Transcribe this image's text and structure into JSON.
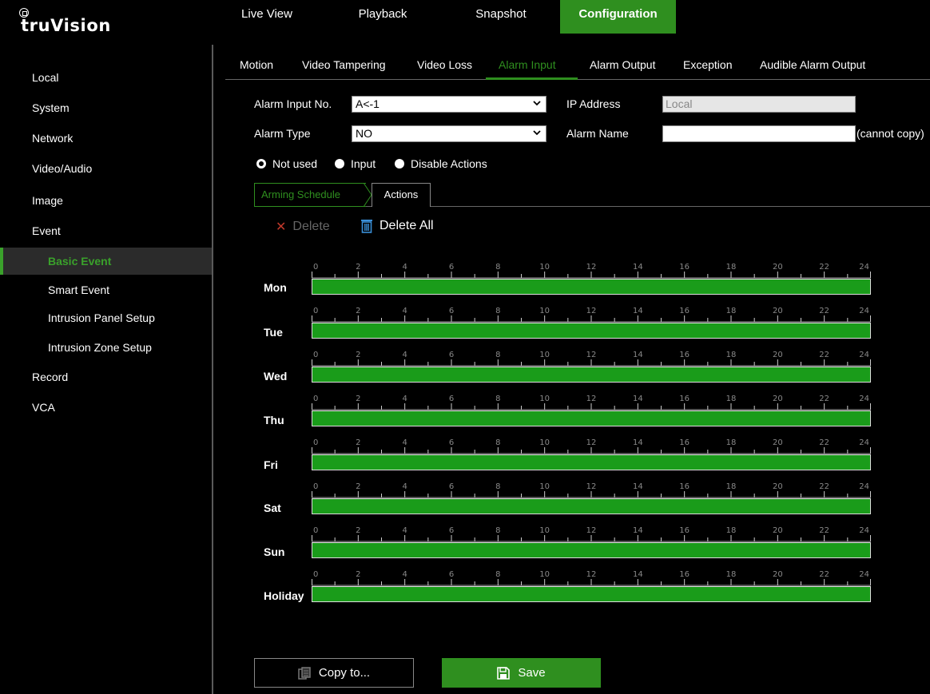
{
  "app": {
    "logo_text": "truVision"
  },
  "top_nav": [
    {
      "label": "Live View"
    },
    {
      "label": "Playback"
    },
    {
      "label": "Snapshot"
    },
    {
      "label": "Configuration"
    }
  ],
  "sidebar": {
    "items": [
      {
        "label": "Local"
      },
      {
        "label": "System"
      },
      {
        "label": "Network"
      },
      {
        "label": "Video/Audio"
      },
      {
        "label": "Image"
      },
      {
        "label": "Event"
      },
      {
        "label": "Basic Event"
      },
      {
        "label": "Smart Event"
      },
      {
        "label": "Intrusion Panel Setup"
      },
      {
        "label": "Intrusion Zone Setup"
      },
      {
        "label": "Record"
      },
      {
        "label": "VCA"
      }
    ]
  },
  "subtabs": [
    {
      "label": "Motion"
    },
    {
      "label": "Video Tampering"
    },
    {
      "label": "Video Loss"
    },
    {
      "label": "Alarm Input"
    },
    {
      "label": "Alarm Output"
    },
    {
      "label": "Exception"
    },
    {
      "label": "Audible Alarm Output"
    }
  ],
  "form": {
    "alarm_input_no_label": "Alarm Input No.",
    "alarm_input_no_value": "A<-1",
    "ip_address_label": "IP Address",
    "ip_address_value": "Local",
    "alarm_type_label": "Alarm Type",
    "alarm_type_value": "NO",
    "alarm_name_label": "Alarm Name",
    "alarm_name_value": "",
    "cannot_copy_note": "(cannot copy)"
  },
  "mode_options": [
    {
      "label": "Not used",
      "checked": true
    },
    {
      "label": "Input",
      "checked": false
    },
    {
      "label": "Disable Actions",
      "checked": false
    }
  ],
  "schedule_tabs": {
    "arming": "Arming Schedule",
    "actions": "Actions"
  },
  "toolbar": {
    "delete_label": "Delete",
    "delete_all_label": "Delete All"
  },
  "schedule": {
    "hour_labels": [
      "0",
      "2",
      "4",
      "6",
      "8",
      "10",
      "12",
      "14",
      "16",
      "18",
      "20",
      "22",
      "24"
    ],
    "days": [
      {
        "label": "Mon",
        "start": 0,
        "end": 24
      },
      {
        "label": "Tue",
        "start": 0,
        "end": 24
      },
      {
        "label": "Wed",
        "start": 0,
        "end": 24
      },
      {
        "label": "Thu",
        "start": 0,
        "end": 24
      },
      {
        "label": "Fri",
        "start": 0,
        "end": 24
      },
      {
        "label": "Sat",
        "start": 0,
        "end": 24
      },
      {
        "label": "Sun",
        "start": 0,
        "end": 24
      },
      {
        "label": "Holiday",
        "start": 0,
        "end": 24
      }
    ]
  },
  "footer": {
    "copy_label": "Copy to...",
    "save_label": "Save"
  },
  "colors": {
    "accent": "#2f8f1f",
    "schedule_bar": "#1a9c1a",
    "delete_x": "#c0392b",
    "delete_all_icon": "#3a8fd8"
  }
}
